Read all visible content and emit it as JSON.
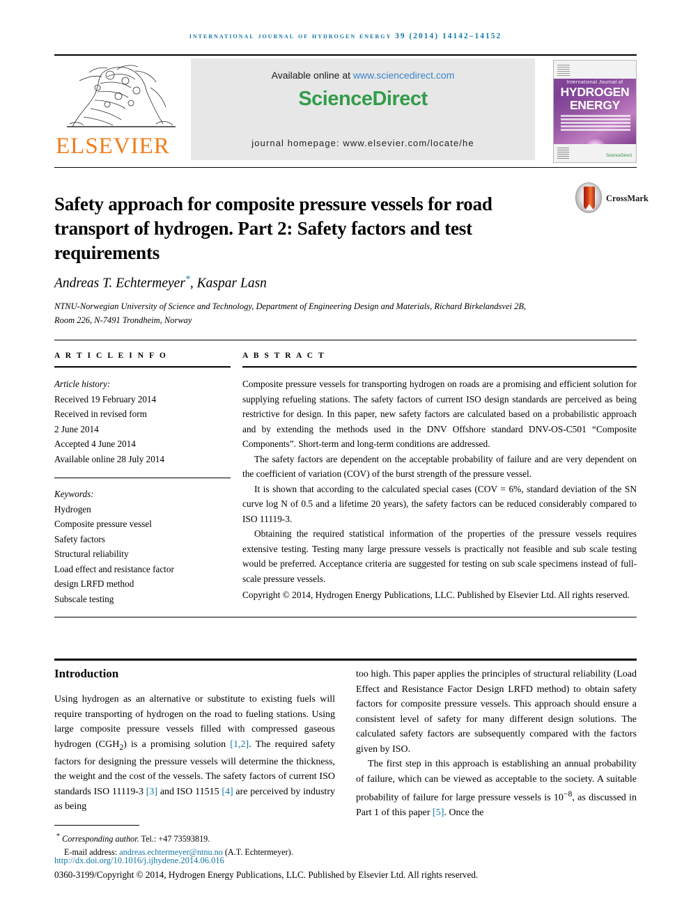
{
  "running_head": "International Journal of Hydrogen Energy 39 (2014) 14142–14152",
  "masthead": {
    "publisher_name": "ELSEVIER",
    "available_prefix": "Available online at ",
    "available_link": "www.sciencedirect.com",
    "sciencedirect_logo": "ScienceDirect",
    "journal_homepage": "journal homepage: www.elsevier.com/locate/he",
    "cover": {
      "line_small": "International Journal of",
      "line_big": "HYDROGEN ENERGY",
      "imprint": "ScienceDirect"
    }
  },
  "article": {
    "title": "Safety approach for composite pressure vessels for road transport of hydrogen. Part 2: Safety factors and test requirements",
    "crossmark_label": "CrossMark",
    "authors": "Andreas T. Echtermeyer",
    "authors_suffix": ", Kaspar Lasn",
    "author_star": "*",
    "affiliation": "NTNU-Norwegian University of Science and Technology, Department of Engineering Design and Materials, Richard Birkelandsvei 2B, Room 226, N-7491 Trondheim, Norway"
  },
  "article_info": {
    "heading": "A R T I C L E  I N F O",
    "history_label": "Article history:",
    "history": [
      "Received 19 February 2014",
      "Received in revised form",
      "2 June 2014",
      "Accepted 4 June 2014",
      "Available online 28 July 2014"
    ],
    "keywords_label": "Keywords:",
    "keywords": [
      "Hydrogen",
      "Composite pressure vessel",
      "Safety factors",
      "Structural reliability",
      "Load effect and resistance factor",
      "design LRFD method",
      "Subscale testing"
    ]
  },
  "abstract": {
    "heading": "A B S T R A C T",
    "paragraphs": [
      "Composite pressure vessels for transporting hydrogen on roads are a promising and efficient solution for supplying refueling stations. The safety factors of current ISO design standards are perceived as being restrictive for design. In this paper, new safety factors are calculated based on a probabilistic approach and by extending the methods used in the DNV Offshore standard DNV-OS-C501 “Composite Components”. Short-term and long-term conditions are addressed.",
      "The safety factors are dependent on the acceptable probability of failure and are very dependent on the coefficient of variation (COV) of the burst strength of the pressure vessel.",
      "It is shown that according to the calculated special cases (COV = 6%, standard deviation of the SN curve log N of 0.5 and a lifetime 20 years), the safety factors can be reduced considerably compared to ISO 11119-3.",
      "Obtaining the required statistical information of the properties of the pressure vessels requires extensive testing. Testing many large pressure vessels is practically not feasible and sub scale testing would be preferred. Acceptance criteria are suggested for testing on sub scale specimens instead of full-scale pressure vessels."
    ],
    "copyright": "Copyright © 2014, Hydrogen Energy Publications, LLC. Published by Elsevier Ltd. All rights reserved."
  },
  "introduction": {
    "heading": "Introduction",
    "left_paragraph_part1": "Using hydrogen as an alternative or substitute to existing fuels will require transporting of hydrogen on the road to fueling stations. Using large composite pressure vessels filled with compressed gaseous hydrogen (CGH",
    "left_sub": "2",
    "left_paragraph_part2": ") is a promising solution ",
    "ref_12": "[1,2]",
    "left_paragraph_part3": ". The required safety factors for designing the pressure vessels will determine the thickness, the weight and the cost of the vessels. The safety factors of current ISO standards ISO 11119-3 ",
    "ref_3": "[3]",
    "left_paragraph_part4": " and ISO 11515 ",
    "ref_4": "[4]",
    "left_paragraph_part5": " are perceived by industry as being",
    "right_paragraph_1": "too high. This paper applies the principles of structural reliability (Load Effect and Resistance Factor Design LRFD method) to obtain safety factors for composite pressure vessels. This approach should ensure a consistent level of safety for many different design solutions. The calculated safety factors are subsequently compared with the factors given by ISO.",
    "right_paragraph_2_part1": "The first step in this approach is establishing an annual probability of failure, which can be viewed as acceptable to the society. A suitable probability of failure for large pressure vessels is 10",
    "right_sup": "−8",
    "right_paragraph_2_part2": ", as discussed in Part 1 of this paper ",
    "ref_5": "[5]",
    "right_paragraph_2_part3": ". Once the"
  },
  "footer": {
    "corresponding_star": "*",
    "corresponding_label": "Corresponding author.",
    "corresponding_tel": " Tel.: +47 73593819.",
    "email_label": "E-mail address: ",
    "email": "andreas.echtermeyer@ntnu.no",
    "email_owner": " (A.T. Echtermeyer).",
    "doi": "http://dx.doi.org/10.1016/j.ijhydene.2014.06.016",
    "issn_line": "0360-3199/Copyright © 2014, Hydrogen Energy Publications, LLC. Published by Elsevier Ltd. All rights reserved."
  },
  "colors": {
    "link": "#1277a8",
    "elsevier_orange": "#ef7d1a",
    "sciencedirect_green": "#339c4a",
    "sd_link_blue": "#3a85c6",
    "banner_gray": "#e7e7e7"
  }
}
